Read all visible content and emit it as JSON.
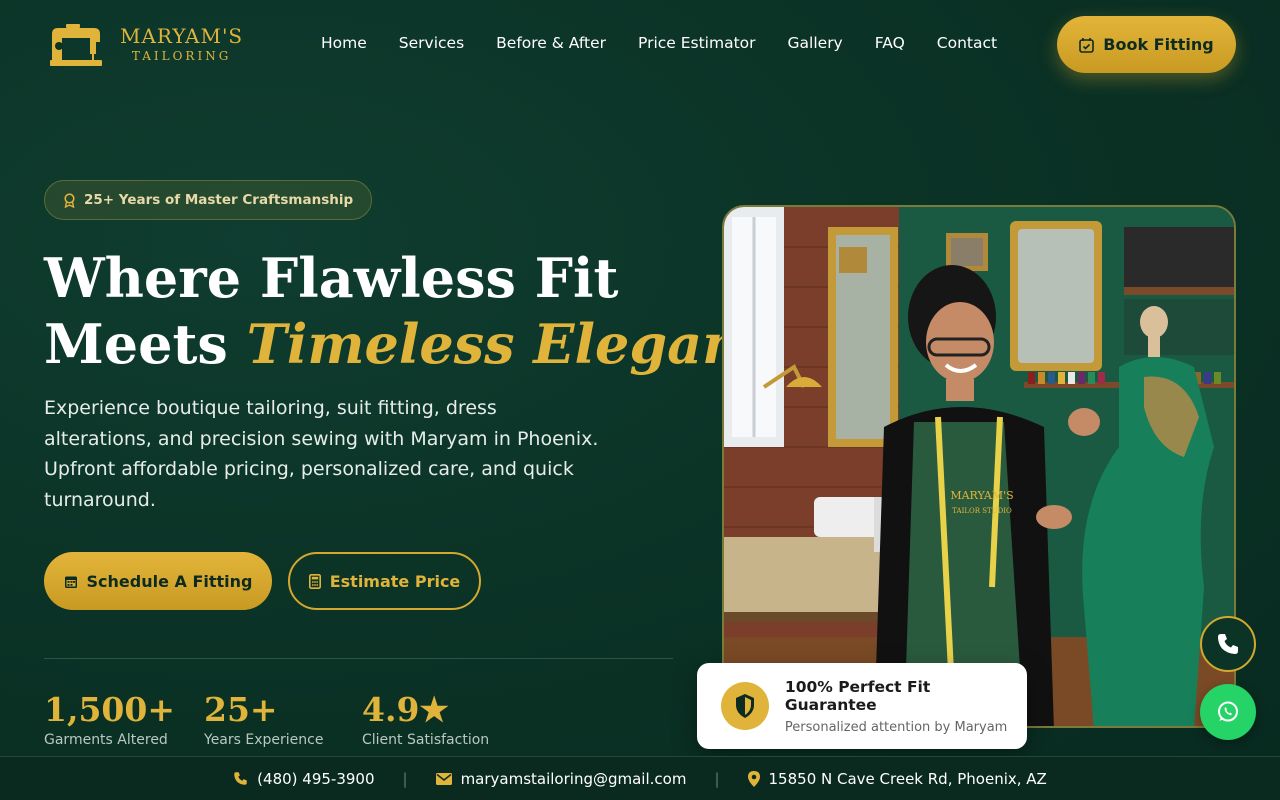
{
  "brand": {
    "title": "MARYAM'S",
    "subtitle": "TAILORING",
    "logo_icon": "sewing-machine-icon"
  },
  "nav": {
    "items": [
      "Home",
      "Services",
      "Before & After",
      "Price Estimator",
      "Gallery",
      "FAQ",
      "Contact"
    ]
  },
  "header": {
    "book_label": "Book Fitting"
  },
  "hero": {
    "badge": "25+ Years of Master Craftsmanship",
    "headline_line1": "Where Flawless Fit",
    "headline_line2_plain": "Meets ",
    "headline_line2_accent": "Timeless Elegance",
    "lead": "Experience boutique tailoring, suit fitting, dress alterations, and precision sewing with Maryam in Phoenix. Upfront affordable pricing, personalized care, and quick turnaround.",
    "primary_cta": "Schedule A Fitting",
    "secondary_cta": "Estimate Price"
  },
  "stats": [
    {
      "value": "1,500+",
      "label": "Garments Altered"
    },
    {
      "value": "25+",
      "label": "Years Experience"
    },
    {
      "value": "4.9★",
      "label": "Client Satisfaction"
    }
  ],
  "photo": {
    "apron_text": "MARYAM'S",
    "apron_sub": "TAILOR STUDIO"
  },
  "guarantee": {
    "title": "100% Perfect Fit Guarantee",
    "subtitle": "Personalized attention by Maryam"
  },
  "contact": {
    "phone": "(480) 495-3900",
    "email": "maryamstailoring@gmail.com",
    "address": "15850 N Cave Creek Rd, Phoenix, AZ"
  },
  "colors": {
    "accent": "#e0b43a",
    "background": "#0b3326",
    "whatsapp": "#25d366"
  }
}
